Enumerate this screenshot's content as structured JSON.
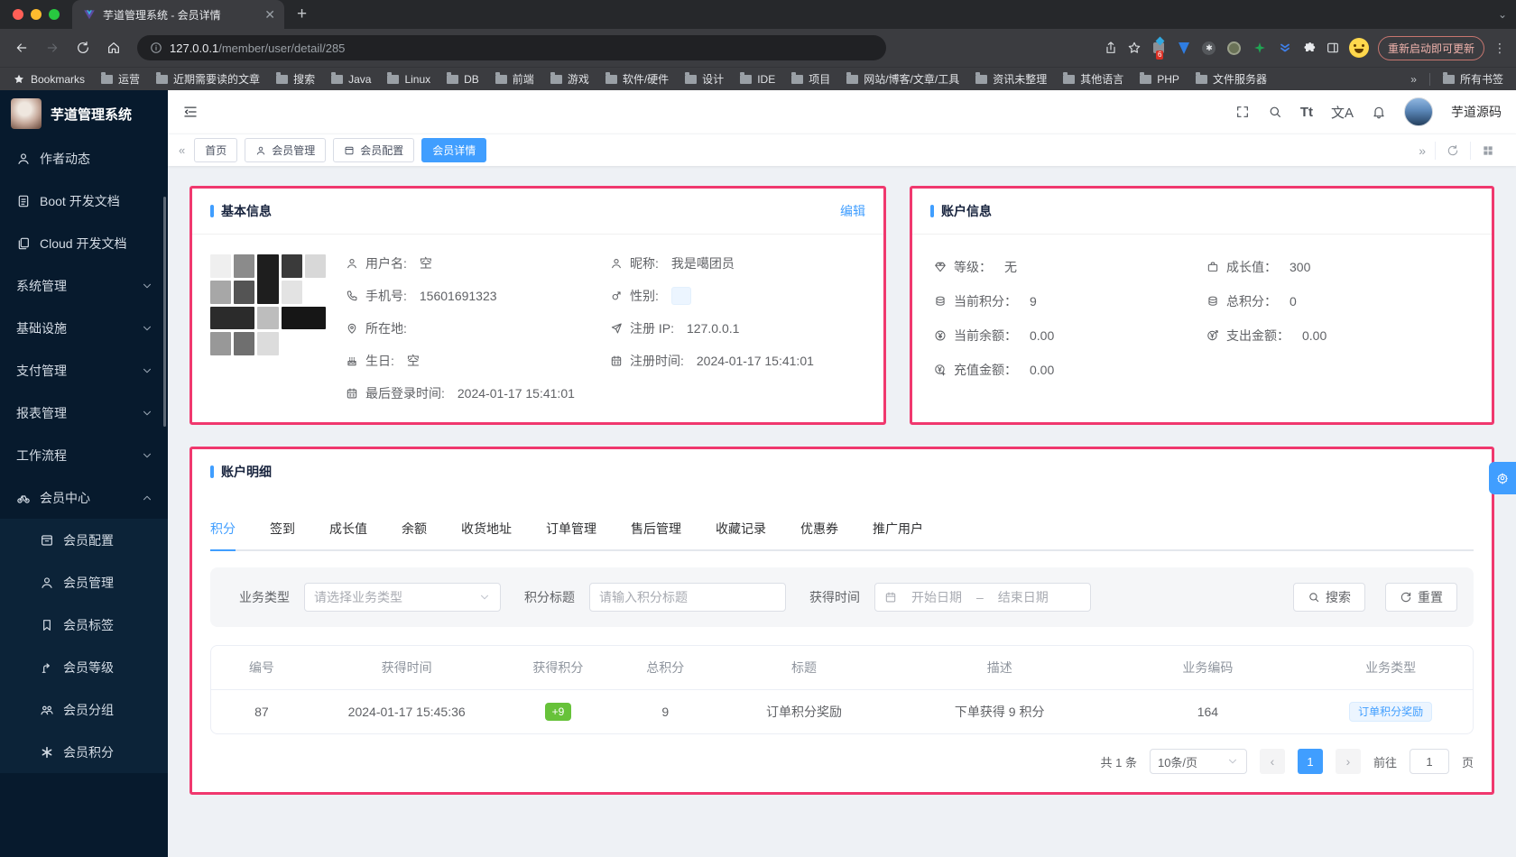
{
  "colors": {
    "primary": "#409eff",
    "annotation": "#f0386e",
    "success": "#67c23a",
    "sidebar_bg": "#071a2d"
  },
  "browser": {
    "tab_title": "芋道管理系统 - 会员详情",
    "url_host": "127.0.0.1",
    "url_path": "/member/user/detail/285",
    "update_button": "重新启动即可更新",
    "extension_badge": "6",
    "bookmarks_label": "Bookmarks",
    "bookmarks": [
      "运营",
      "近期需要读的文章",
      "搜索",
      "Java",
      "Linux",
      "DB",
      "前端",
      "游戏",
      "软件/硬件",
      "设计",
      "IDE",
      "项目",
      "网站/博客/文章/工具",
      "资讯未整理",
      "其他语言",
      "PHP",
      "文件服务器"
    ],
    "bookmarks_overflow": "»",
    "all_bookmarks_label": "所有书签"
  },
  "sidebar": {
    "app_title": "芋道管理系统",
    "items": [
      {
        "label": "作者动态"
      },
      {
        "label": "Boot 开发文档"
      },
      {
        "label": "Cloud 开发文档"
      },
      {
        "label": "系统管理"
      },
      {
        "label": "基础设施"
      },
      {
        "label": "支付管理"
      },
      {
        "label": "报表管理"
      },
      {
        "label": "工作流程"
      },
      {
        "label": "会员中心"
      }
    ],
    "submenu": [
      {
        "label": "会员配置"
      },
      {
        "label": "会员管理"
      },
      {
        "label": "会员标签"
      },
      {
        "label": "会员等级"
      },
      {
        "label": "会员分组"
      },
      {
        "label": "会员积分"
      }
    ]
  },
  "navbar": {
    "username": "芋道源码",
    "font_icon": "Tt",
    "translate_icon": "文A"
  },
  "tags": {
    "items": [
      "首页",
      "会员管理",
      "会员配置",
      "会员详情"
    ]
  },
  "basic_info": {
    "title": "基本信息",
    "edit_link": "编辑",
    "left": [
      {
        "label": "用户名:",
        "value": "空"
      },
      {
        "label": "手机号:",
        "value": "15601691323"
      },
      {
        "label": "所在地:",
        "value": ""
      },
      {
        "label": "生日:",
        "value": "空"
      },
      {
        "label": "最后登录时间:",
        "value": "2024-01-17 15:41:01"
      }
    ],
    "right": [
      {
        "label": "昵称:",
        "value": "我是噶团员"
      },
      {
        "label": "性别:",
        "value": ""
      },
      {
        "label": "注册 IP:",
        "value": "127.0.0.1"
      },
      {
        "label": "注册时间:",
        "value": "2024-01-17 15:41:01"
      }
    ]
  },
  "account_info": {
    "title": "账户信息",
    "left": [
      {
        "label": "等级：",
        "value": "无"
      },
      {
        "label": "当前积分：",
        "value": "9"
      },
      {
        "label": "当前余额：",
        "value": "0.00"
      },
      {
        "label": "充值金额：",
        "value": "0.00"
      }
    ],
    "right": [
      {
        "label": "成长值：",
        "value": "300"
      },
      {
        "label": "总积分：",
        "value": "0"
      },
      {
        "label": "支出金额：",
        "value": "0.00"
      }
    ]
  },
  "account_detail": {
    "title": "账户明细",
    "tabs": [
      "积分",
      "签到",
      "成长值",
      "余额",
      "收货地址",
      "订单管理",
      "售后管理",
      "收藏记录",
      "优惠券",
      "推广用户"
    ],
    "active_tab": "积分",
    "filter": {
      "type_label": "业务类型",
      "type_placeholder": "请选择业务类型",
      "title_label": "积分标题",
      "title_placeholder": "请输入积分标题",
      "time_label": "获得时间",
      "start_placeholder": "开始日期",
      "range_separator": "–",
      "end_placeholder": "结束日期",
      "search_button": "搜索",
      "reset_button": "重置"
    },
    "table": {
      "headers": [
        "编号",
        "获得时间",
        "获得积分",
        "总积分",
        "标题",
        "描述",
        "业务编码",
        "业务类型"
      ],
      "row": {
        "id": "87",
        "time": "2024-01-17 15:45:36",
        "points": "+9",
        "total": "9",
        "title": "订单积分奖励",
        "description": "下单获得 9 积分",
        "biz_code": "164",
        "biz_type": "订单积分奖励"
      }
    },
    "pagination": {
      "total": "共 1 条",
      "page_size": "10条/页",
      "prev": "‹",
      "page": "1",
      "next": "›",
      "goto_label": "前往",
      "goto_value": "1",
      "unit_label": "页"
    }
  }
}
